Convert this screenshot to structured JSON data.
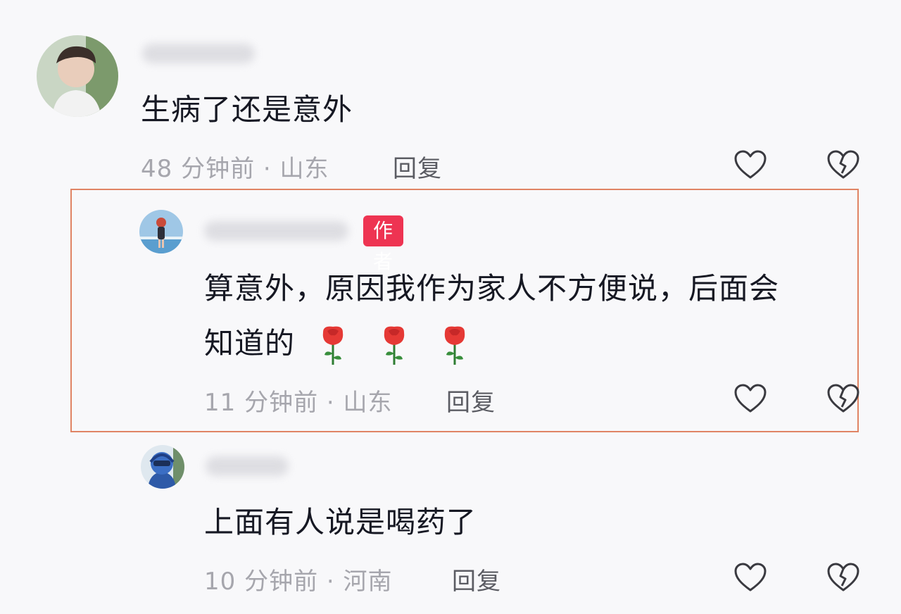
{
  "comments": [
    {
      "text": "生病了还是意外",
      "time": "48 分钟前 · 山东",
      "reply_label": "回复"
    },
    {
      "badge": "作者",
      "text_line1": "算意外，原因我作为家人不方便说，后面会",
      "text_line2": "知道的",
      "emoji": [
        "rose",
        "rose",
        "rose"
      ],
      "time": "11 分钟前 · 山东",
      "reply_label": "回复"
    },
    {
      "text": "上面有人说是喝药了",
      "time": "10 分钟前 · 河南",
      "reply_label": "回复"
    }
  ],
  "icons": {
    "like": "heart-outline-icon",
    "dislike": "broken-heart-icon",
    "rose": "rose-emoji"
  },
  "colors": {
    "badge": "#ee3452",
    "highlight_border": "#e08464",
    "meta_text": "#a6a6ad"
  }
}
